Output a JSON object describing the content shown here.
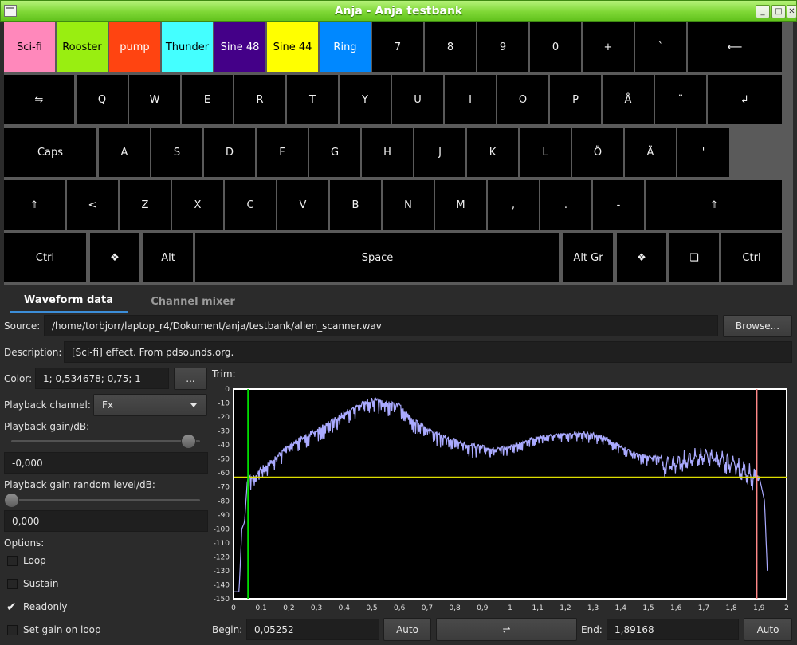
{
  "window": {
    "title": "Anja - Anja testbank"
  },
  "window_controls": {
    "minimize": "_",
    "maximize": "□",
    "close": "✕"
  },
  "keyboard": {
    "row1": [
      {
        "label": "Sci-fi",
        "bg": "#ff88bb",
        "fg": "#000000"
      },
      {
        "label": "Rooster",
        "bg": "#99ee11",
        "fg": "#000000"
      },
      {
        "label": "pump",
        "bg": "#ff4411",
        "fg": "#ffffff"
      },
      {
        "label": "Thunder",
        "bg": "#44ffff",
        "fg": "#000000"
      },
      {
        "label": "Sine 48",
        "bg": "#440088",
        "fg": "#ffffff"
      },
      {
        "label": "Sine 44",
        "bg": "#ffff00",
        "fg": "#000000"
      },
      {
        "label": "Ring",
        "bg": "#0088ff",
        "fg": "#ffffff"
      },
      {
        "label": "7"
      },
      {
        "label": "8"
      },
      {
        "label": "9"
      },
      {
        "label": "0"
      },
      {
        "label": "+"
      },
      {
        "label": "`"
      },
      {
        "label": "⟵"
      }
    ],
    "row2": [
      "⇋",
      "Q",
      "W",
      "E",
      "R",
      "T",
      "Y",
      "U",
      "I",
      "O",
      "P",
      "Å",
      "¨",
      "↲"
    ],
    "row3": [
      "Caps",
      "A",
      "S",
      "D",
      "F",
      "G",
      "H",
      "J",
      "K",
      "L",
      "Ö",
      "Ä",
      "'"
    ],
    "row4": [
      "⇑",
      "<",
      "Z",
      "X",
      "C",
      "V",
      "B",
      "N",
      "M",
      ",",
      ".",
      "-",
      "⇑"
    ],
    "row5": [
      "Ctrl",
      "❖",
      "Alt",
      "Space",
      "Alt Gr",
      "❖",
      "❑",
      "Ctrl"
    ]
  },
  "tabs": [
    "Waveform data",
    "Channel mixer"
  ],
  "form": {
    "source_label": "Source:",
    "source_value": "/home/torbjorr/laptop_r4/Dokument/anja/testbank/alien_scanner.wav",
    "browse_label": "Browse...",
    "description_label": "Description:",
    "description_value": "[Sci-fi] effect. From pdsounds.org.",
    "color_label": "Color:",
    "color_value": "1; 0,534678; 0,75; 1",
    "color_button": "...",
    "trim_label": "Trim:",
    "playback_channel_label": "Playback channel:",
    "playback_channel_value": "Fx",
    "gain_label": "Playback gain/dB:",
    "gain_slider_level": 0.94,
    "gain_value": "-0,000",
    "gain_random_label": "Playback gain random level/dB:",
    "gain_random_slider_level": 0.0,
    "gain_random_value": "0,000",
    "options_label": "Options:",
    "options": [
      {
        "label": "Loop",
        "checked": false
      },
      {
        "label": "Sustain",
        "checked": false
      },
      {
        "label": "Readonly",
        "checked": true
      },
      {
        "label": "Set gain on loop",
        "checked": false
      }
    ],
    "begin_label": "Begin:",
    "begin_value": "0,05252",
    "auto_label": "Auto",
    "swap_label": "⇌",
    "end_label": "End:",
    "end_value": "1,89168"
  },
  "chart_data": {
    "type": "line",
    "xlim": [
      0,
      2
    ],
    "ylim": [
      -150,
      0
    ],
    "x_ticks": [
      "0",
      "0,1",
      "0,2",
      "0,3",
      "0,4",
      "0,5",
      "0,6",
      "0,7",
      "0,8",
      "0,9",
      "1",
      "1,1",
      "1,2",
      "1,3",
      "1,4",
      "1,5",
      "1,6",
      "1,7",
      "1,8",
      "1,9",
      "2"
    ],
    "y_ticks": [
      "0",
      "-10",
      "-20",
      "-30",
      "-40",
      "-50",
      "-60",
      "-70",
      "-80",
      "-90",
      "-100",
      "-110",
      "-120",
      "-130",
      "-140",
      "-150"
    ],
    "begin_marker": 0.05252,
    "end_marker": 1.89168,
    "threshold_db": -63,
    "colors": {
      "waveform": "#aaaaff",
      "begin": "#00dd00",
      "end": "#ff8888",
      "threshold": "#dddd00"
    },
    "waveform": {
      "x": [
        0.0,
        0.02,
        0.03,
        0.04,
        0.05,
        0.06,
        0.08,
        0.1,
        0.15,
        0.2,
        0.25,
        0.3,
        0.35,
        0.4,
        0.45,
        0.5,
        0.55,
        0.6,
        0.65,
        0.7,
        0.75,
        0.8,
        0.85,
        0.9,
        0.95,
        1.0,
        1.05,
        1.1,
        1.15,
        1.2,
        1.25,
        1.3,
        1.35,
        1.4,
        1.45,
        1.5,
        1.55,
        1.6,
        1.65,
        1.7,
        1.75,
        1.8,
        1.85,
        1.88,
        1.9,
        1.92,
        1.93
      ],
      "y": [
        -145,
        -145,
        -100,
        -95,
        -65,
        -62,
        -60,
        -55,
        -48,
        -38,
        -33,
        -28,
        -22,
        -15,
        -10,
        -6,
        -8,
        -10,
        -20,
        -26,
        -32,
        -35,
        -38,
        -40,
        -42,
        -40,
        -36,
        -33,
        -32,
        -31,
        -30,
        -31,
        -34,
        -40,
        -45,
        -47,
        -48,
        -45,
        -42,
        -40,
        -42,
        -45,
        -50,
        -55,
        -62,
        -80,
        -130
      ]
    }
  }
}
